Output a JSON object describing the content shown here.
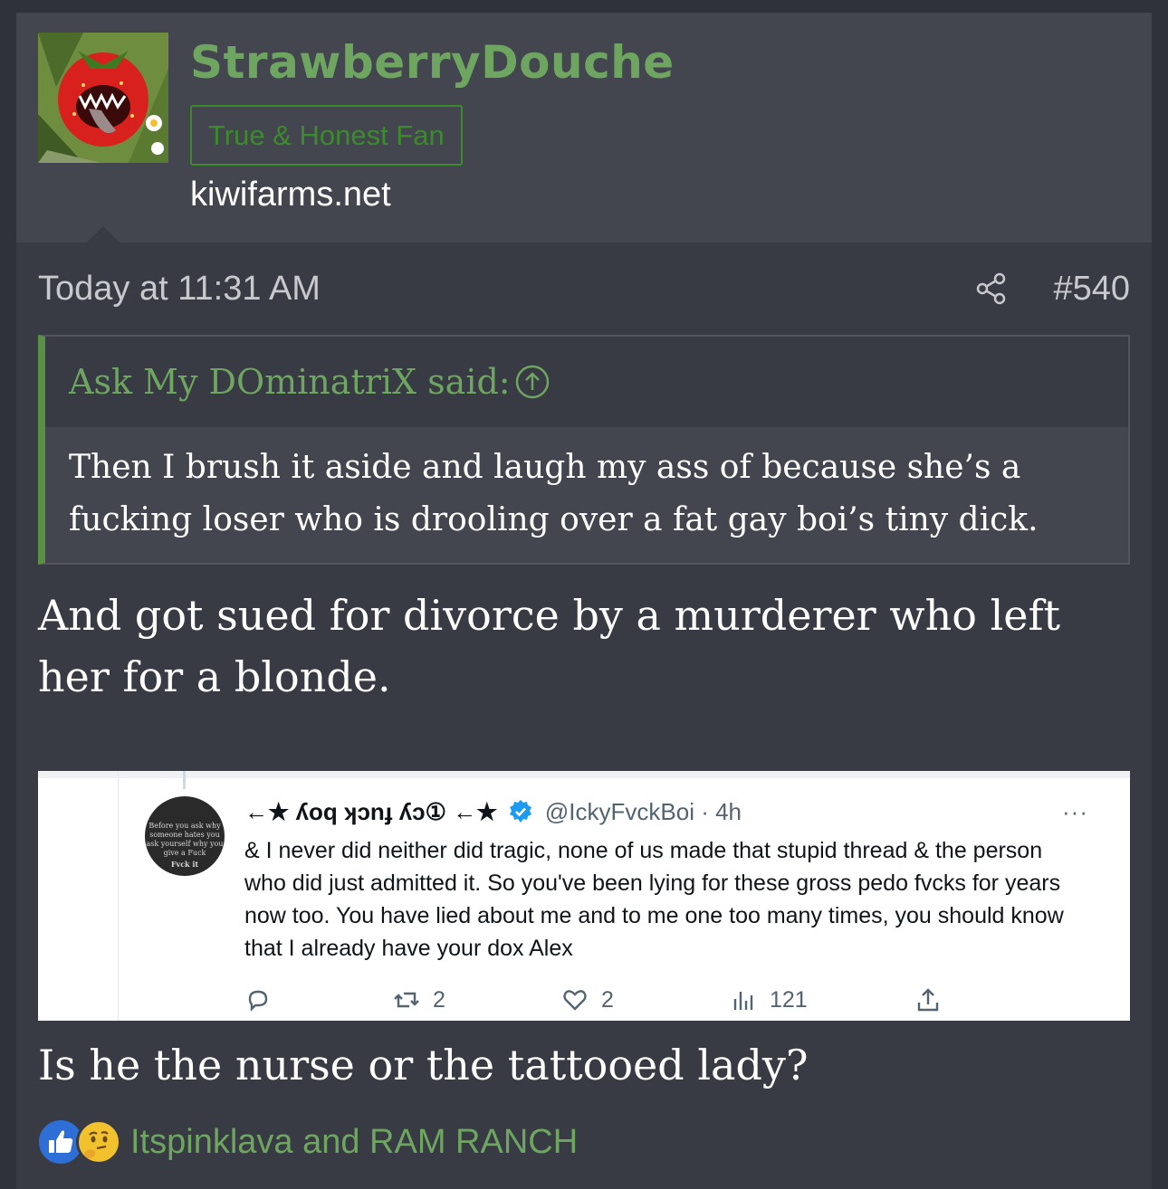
{
  "user": {
    "name": "StrawberryDouche",
    "title": "True & Honest Fan",
    "site": "kiwifarms.net"
  },
  "meta": {
    "time": "Today at 11:31 AM",
    "post_number": "#540"
  },
  "quote": {
    "author": "Ask My DOminatriX said:",
    "text": "Then I brush it aside and laugh my ass of because she’s a fucking loser who is drooling over a fat gay boi’s tiny dick."
  },
  "body": {
    "text1": "And got sued for divorce by a murderer who left her for a blonde.",
    "text2": "Is he the nurse or the tattooed lady?"
  },
  "tweet": {
    "display_name": "←★ ʎoq ʞɔnɟ ʎɔ① ←★",
    "handle": "@IckyFvckBoi · 4h",
    "text": "& I never did neither did tragic, none of us made that stupid thread & the person who did just admitted it. So you've been lying for these gross pedo fvcks for years now too. You have lied about me and to me one too many times, you should know that I already have your dox Alex",
    "avatar_text": "Before you ask why someone hates you ask yourself why you give a Fuck",
    "avatar_caption": "Fvck it",
    "retweets": "2",
    "likes": "2",
    "views": "121",
    "more": "···"
  },
  "reactions": {
    "users": "Itspinklava and RAM RANCH",
    "icons": [
      "like-icon",
      "thinking-face-icon"
    ]
  },
  "colors": {
    "accent_green": "#6ea560",
    "title_green": "#3d8a2e",
    "quote_bar": "#5a8f46",
    "background": "#383b43"
  }
}
